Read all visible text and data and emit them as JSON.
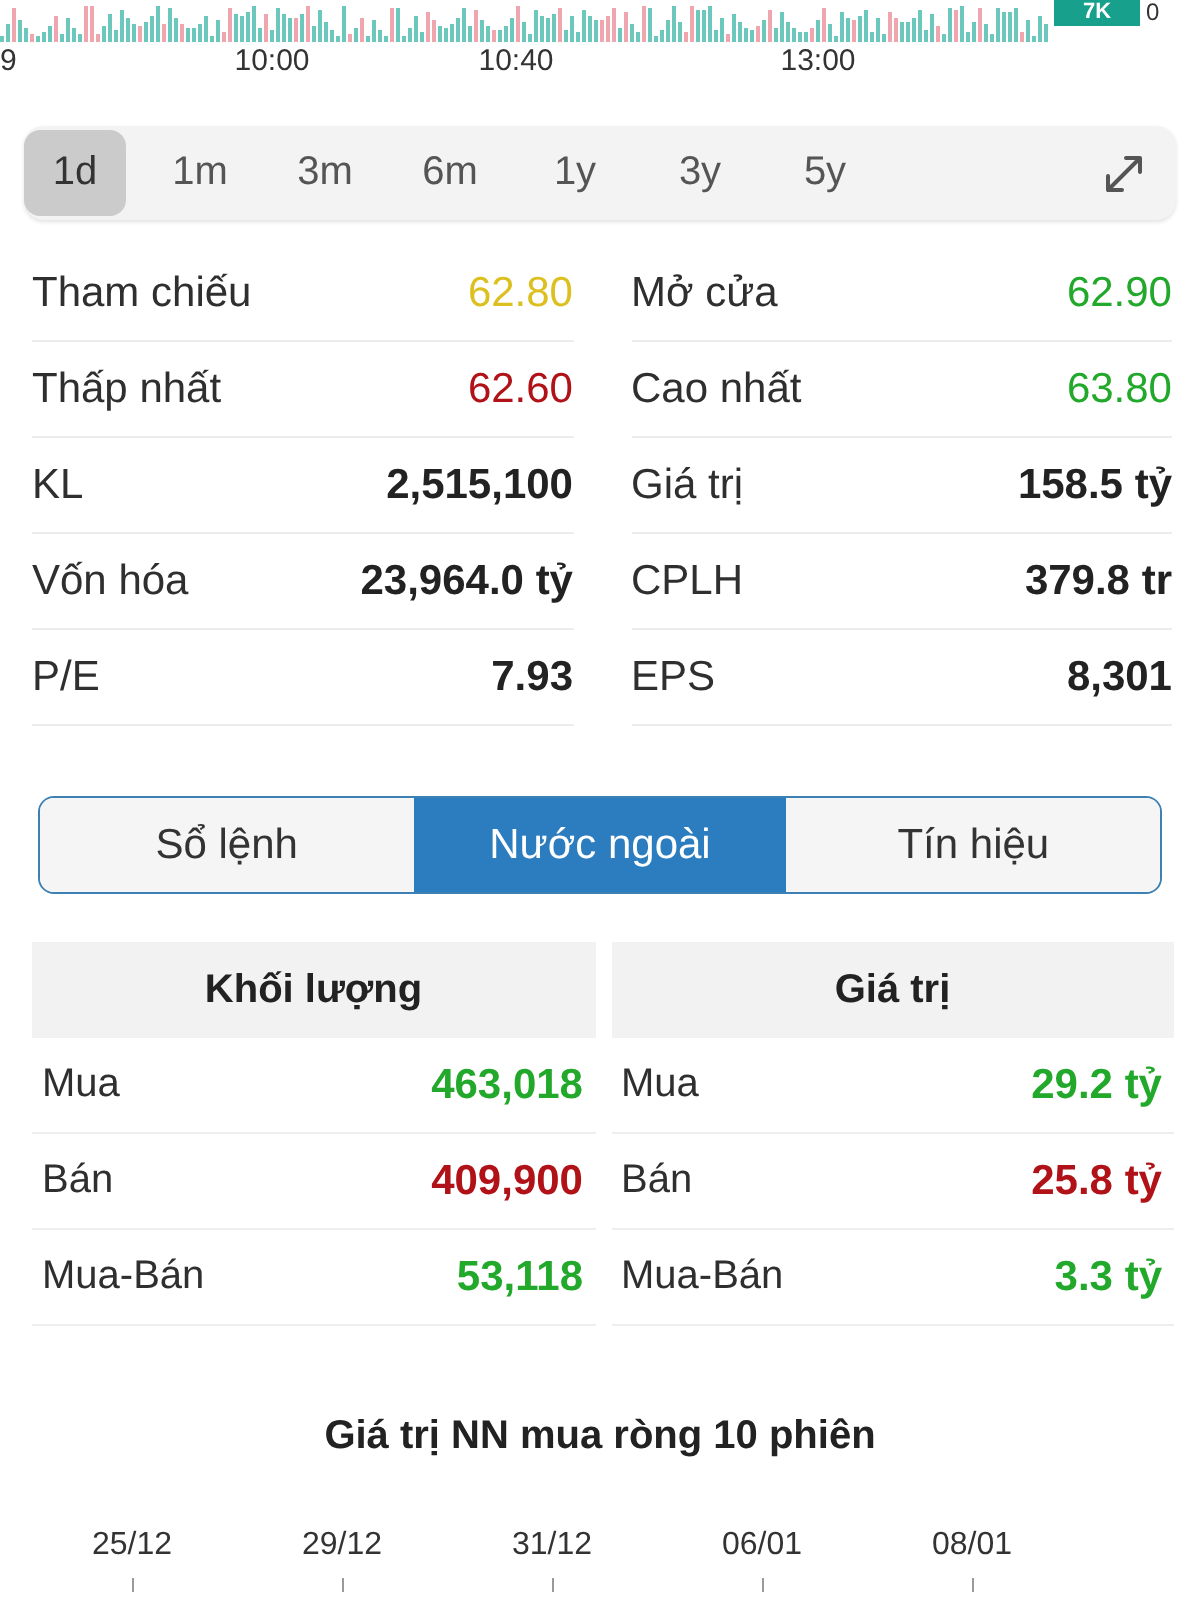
{
  "intraday_chart": {
    "badge": "7K",
    "axis_value": "0",
    "time_labels": [
      "9",
      "10:00",
      "10:40",
      "13:00"
    ]
  },
  "period_tabs": [
    {
      "label": "1d",
      "selected": true
    },
    {
      "label": "1m",
      "selected": false
    },
    {
      "label": "3m",
      "selected": false
    },
    {
      "label": "6m",
      "selected": false
    },
    {
      "label": "1y",
      "selected": false
    },
    {
      "label": "3y",
      "selected": false
    },
    {
      "label": "5y",
      "selected": false
    }
  ],
  "stats": [
    {
      "label": "Tham chiếu",
      "value": "62.80",
      "color": "#dcc020"
    },
    {
      "label": "Mở cửa",
      "value": "62.90",
      "color": "#22a82a"
    },
    {
      "label": "Thấp nhất",
      "value": "62.60",
      "color": "#b01218"
    },
    {
      "label": "Cao nhất",
      "value": "63.80",
      "color": "#22a82a"
    },
    {
      "label": "KL",
      "value": "2,515,100"
    },
    {
      "label": "Giá trị",
      "value": "158.5 tỷ"
    },
    {
      "label": "Vốn hóa",
      "value": "23,964.0 tỷ"
    },
    {
      "label": "CPLH",
      "value": "379.8 tr"
    },
    {
      "label": "P/E",
      "value": "7.93"
    },
    {
      "label": "EPS",
      "value": "8,301"
    }
  ],
  "segment_tabs": [
    {
      "label": "Sổ lệnh",
      "selected": false
    },
    {
      "label": "Nước ngoài",
      "selected": true
    },
    {
      "label": "Tín hiệu",
      "selected": false
    }
  ],
  "foreign_trading": [
    {
      "title": "Khối lượng",
      "rows": [
        {
          "label": "Mua",
          "value": "463,018",
          "color": "#22a82a"
        },
        {
          "label": "Bán",
          "value": "409,900",
          "color": "#b01218"
        },
        {
          "label": "Mua-Bán",
          "value": "53,118",
          "color": "#22a82a"
        }
      ]
    },
    {
      "title": "Giá trị",
      "rows": [
        {
          "label": "Mua",
          "value": "29.2 tỷ",
          "color": "#22a82a"
        },
        {
          "label": "Bán",
          "value": "25.8 tỷ",
          "color": "#b01218"
        },
        {
          "label": "Mua-Bán",
          "value": "3.3 tỷ",
          "color": "#22a82a"
        }
      ]
    }
  ],
  "net_buy_chart": {
    "title": "Giá trị NN mua ròng 10 phiên",
    "x_labels": [
      "25/12",
      "29/12",
      "31/12",
      "06/01",
      "08/01"
    ]
  }
}
